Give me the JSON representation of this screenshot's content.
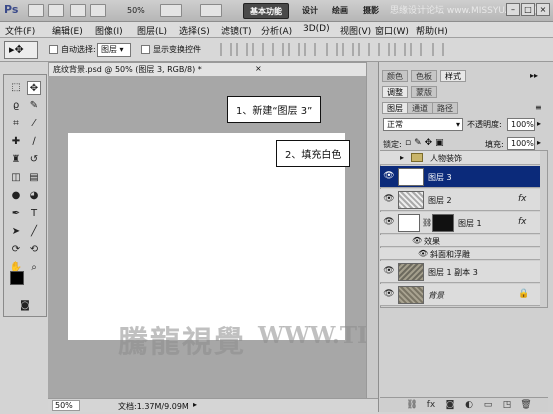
{
  "app": {
    "logo": "Ps",
    "zoom": "50%",
    "watermark_top": "思缘设计论坛 www.MISSYUAN.COM"
  },
  "workspaces": [
    "基本功能",
    "设计",
    "绘画",
    "摄影"
  ],
  "window_buttons": [
    "–",
    "□",
    "×"
  ],
  "menu": [
    "文件(F)",
    "编辑(E)",
    "图像(I)",
    "图层(L)",
    "选择(S)",
    "滤镜(T)",
    "分析(A)",
    "3D(D)",
    "视图(V)",
    "窗口(W)",
    "帮助(H)"
  ],
  "options": {
    "auto_select_label": "自动选择:",
    "auto_select_value": "图层",
    "show_transform_label": "显示变换控件"
  },
  "document": {
    "tab_title": "底纹背景.psd @ 50% (图层 3, RGB/8) *",
    "zoom": "50%",
    "doc_info": "文档:1.37M/9.09M"
  },
  "annotations": {
    "step1": "1、新建“图层 3”",
    "step2": "2、填充白色"
  },
  "watermark": {
    "chinese": "騰龍視覺",
    "url": "WWW.TLVI.NET"
  },
  "panels": {
    "top_tabs": [
      "颜色",
      "色板",
      "样式"
    ],
    "adjust_tabs": [
      "调整",
      "蒙版"
    ],
    "layer_tabs": [
      "图层",
      "通道",
      "路径"
    ],
    "blend_mode": "正常",
    "opacity_label": "不透明度:",
    "opacity_value": "100%",
    "lock_label": "锁定:",
    "fill_label": "填充:",
    "fill_value": "100%"
  },
  "layers": [
    {
      "name": "人物装饰",
      "type": "group",
      "visible": false
    },
    {
      "name": "图层 3",
      "selected": true,
      "visible": true
    },
    {
      "name": "图层 2",
      "visible": true,
      "fx": "fx"
    },
    {
      "name": "图层 1",
      "visible": true,
      "fx": "fx",
      "effects_label": "效果",
      "effect_item": "斜面和浮雕"
    },
    {
      "name": "图层 1 副本 3",
      "visible": true
    },
    {
      "name": "背景",
      "visible": true,
      "locked": true
    }
  ],
  "colors": {
    "selection": "#0b2a7a",
    "canvas_bg": "#a7a7a7"
  }
}
